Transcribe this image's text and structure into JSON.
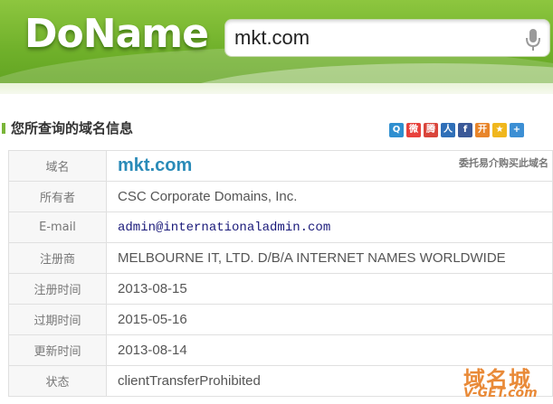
{
  "header": {
    "logo_text": "DoName",
    "search": {
      "value": "mkt.com",
      "mic_icon": "microphone-icon"
    }
  },
  "section": {
    "title": "您所查询的域名信息",
    "share_icons": [
      "qzone-icon",
      "weibo-icon",
      "tencent-weibo-icon",
      "renren-icon",
      "facebook-icon",
      "kaixin-icon",
      "favorite-icon",
      "more-icon"
    ]
  },
  "whois": {
    "rows": [
      {
        "label": "域名",
        "value": "mkt.com",
        "extra": "委托易介购买此域名"
      },
      {
        "label": "所有者",
        "value": "CSC Corporate Domains, Inc."
      },
      {
        "label": "E-mail",
        "value": "admin@internationaladmin.com"
      },
      {
        "label": "注册商",
        "value": "MELBOURNE IT, LTD. D/B/A INTERNET NAMES WORLDWIDE"
      },
      {
        "label": "注册时间",
        "value": "2013-08-15"
      },
      {
        "label": "过期时间",
        "value": "2015-05-16"
      },
      {
        "label": "更新时间",
        "value": "2013-08-14"
      },
      {
        "label": "状态",
        "value": "clientTransferProhibited"
      }
    ]
  },
  "watermark": {
    "cn": "域名城",
    "en": "V-GET.com"
  },
  "colors": {
    "header_green": "#6fb02a",
    "domain_blue": "#2a8bb8",
    "watermark_orange": "#e98a38"
  }
}
